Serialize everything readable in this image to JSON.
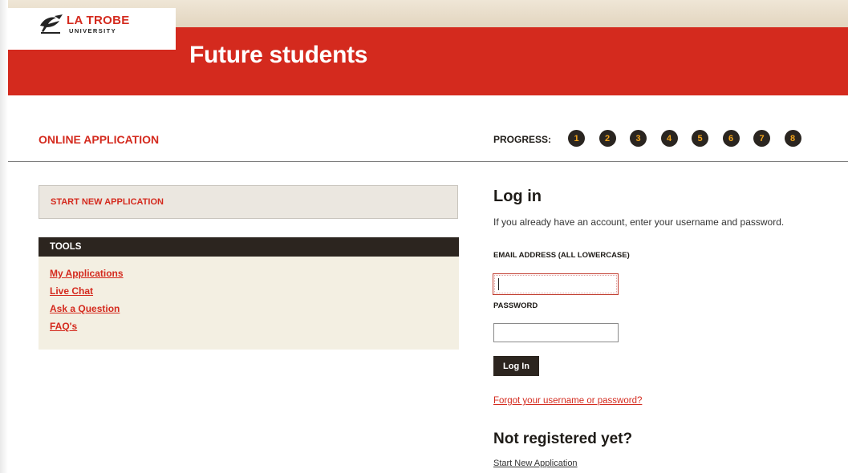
{
  "brand": {
    "logo_main": "LA TROBE",
    "logo_sub": "UNIVERSITY",
    "banner_title": "Future students",
    "colors": {
      "accent": "#d42a1e",
      "dark": "#2c251f",
      "step_number": "#f2a31b"
    }
  },
  "application": {
    "section_title": "ONLINE APPLICATION",
    "progress_label": "PROGRESS:",
    "steps": [
      "1",
      "2",
      "3",
      "4",
      "5",
      "6",
      "7",
      "8"
    ]
  },
  "sidebar": {
    "start_new": "START NEW APPLICATION",
    "tools_title": "TOOLS",
    "tools": [
      {
        "label": "My Applications"
      },
      {
        "label": "Live Chat"
      },
      {
        "label": "Ask a Question"
      },
      {
        "label": "FAQ's"
      }
    ]
  },
  "login": {
    "heading": "Log in",
    "description": "If you already have an account, enter your username and password.",
    "email_label": "EMAIL ADDRESS (ALL LOWERCASE)",
    "email_value": "",
    "password_label": "PASSWORD",
    "password_value": "",
    "button_label": "Log In",
    "forgot_link": "Forgot your username or password?"
  },
  "register": {
    "heading": "Not registered yet?",
    "link": "Start New Application"
  }
}
